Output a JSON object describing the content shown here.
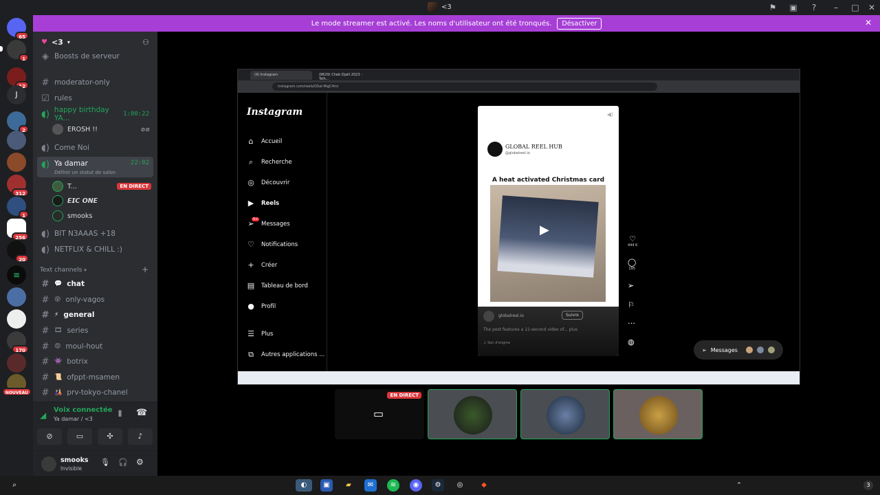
{
  "window": {
    "title": "<3"
  },
  "banner": {
    "message": "Le mode streamer est activé. Les noms d'utilisateur ont été tronqués.",
    "button": "Désactiver"
  },
  "servers": {
    "badges": [
      "65",
      "1",
      "12",
      "2",
      "312",
      "1",
      "256",
      "20",
      "170",
      "NOUVEAU"
    ],
    "j_label": "J"
  },
  "sidebar": {
    "server_name": "<3",
    "boosts": "Boosts de serveur",
    "channels": [
      {
        "label": "moderator-only"
      },
      {
        "label": "rules"
      },
      {
        "label": "happy birthday YA...",
        "time": "1:00:22"
      },
      {
        "label": "Come Noi"
      },
      {
        "label": "Ya damar",
        "time": "22:02",
        "status": "Définir un statut de salon"
      },
      {
        "label": "BIT N3AAAS +18"
      },
      {
        "label": "NETFLIX & CHILL :)"
      }
    ],
    "voice_users_birthday": [
      {
        "name": "EROSH !!"
      }
    ],
    "voice_users_damar": [
      {
        "name": "T...",
        "live": "EN DIRECT"
      },
      {
        "name": "𝙀𝙄𝘾 𝙊𝙉𝙀"
      },
      {
        "name": "smooks"
      }
    ],
    "category": "Text channels",
    "text_channels": [
      {
        "label": "chat"
      },
      {
        "label": "only-vagos"
      },
      {
        "label": "general"
      },
      {
        "label": "series"
      },
      {
        "label": "moul-hout"
      },
      {
        "label": "botrix"
      },
      {
        "label": "ofppt-msamen"
      },
      {
        "label": "prv-tokyo-chanel"
      }
    ]
  },
  "voice_panel": {
    "status": "Voix connectée",
    "channel": "Ya damar / <3",
    "username": "smooks",
    "user_status": "Invisible"
  },
  "stream": {
    "tab1": "(9) Instagram",
    "tab2": "(8629) Cheb Djalil 2023 - Telh...",
    "url": "instagram.com/reels/DSal-MqjC4m/",
    "instagram": {
      "logo": "Instagram",
      "nav": [
        "Accueil",
        "Recherche",
        "Découvrir",
        "Reels",
        "Messages",
        "Notifications",
        "Créer",
        "Tableau de bord",
        "Profil",
        "Plus",
        "Autres applications ..."
      ],
      "messages_badge": "9+",
      "reel": {
        "account": "GLOBAL REEL HUB",
        "handle": "@globalreel.io",
        "caption": "A heat activated Christmas card",
        "footer_user": "globalreel.io",
        "follow": "Suivre",
        "desc": "The post features a 11-second video of... plus",
        "audio": "Son d'origine",
        "likes": "444 K",
        "comments": "195"
      },
      "messages_label": "Messages"
    },
    "live_badge": "EN DIRECT"
  },
  "taskbar": {
    "chip": "3"
  },
  "colors": {
    "banner": "#a73fd6",
    "rail": "#1e1f22",
    "sidebar": "#2b2d31",
    "live": "#da373c",
    "voice_green": "#23a55a"
  }
}
